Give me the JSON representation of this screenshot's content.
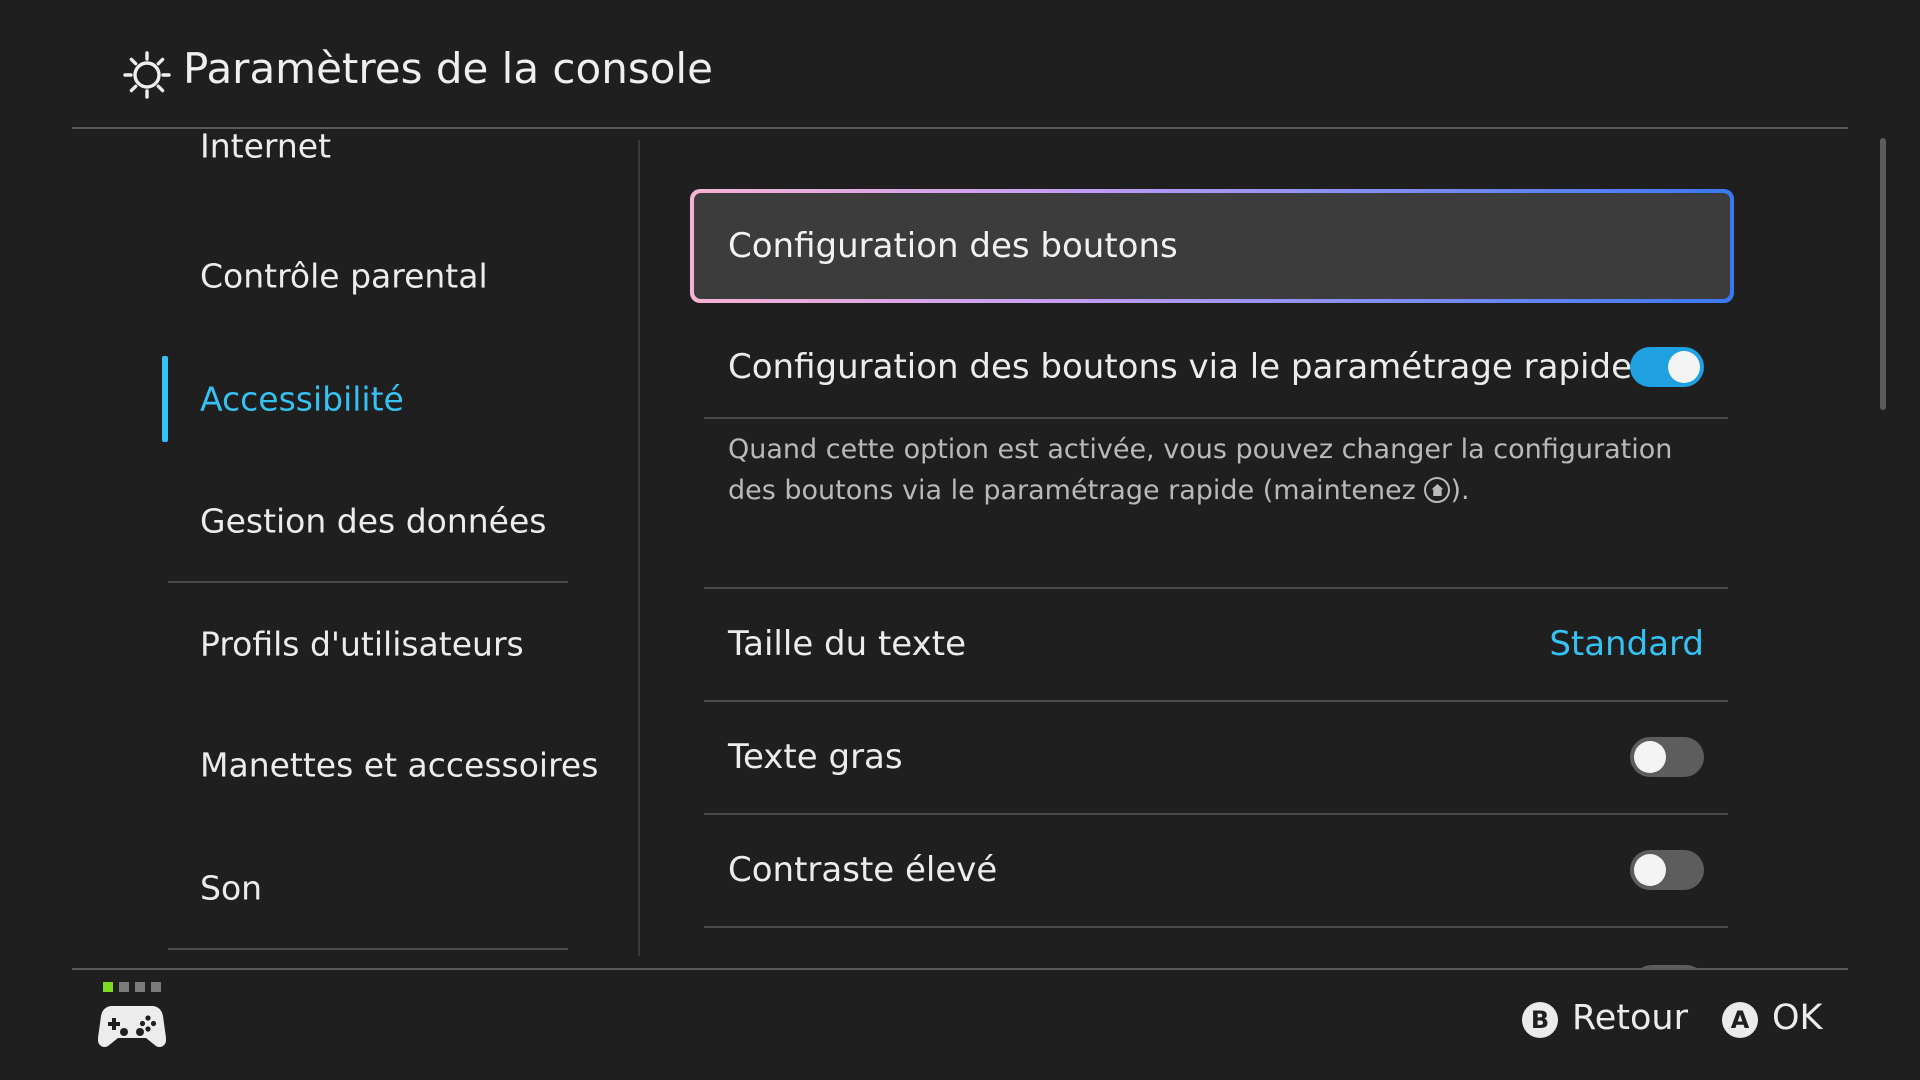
{
  "header": {
    "icon": "gear-icon",
    "title": "Paramètres de la console"
  },
  "sidebar": {
    "items": [
      {
        "label": "Internet"
      },
      {
        "label": "Contrôle parental"
      },
      {
        "label": "Accessibilité",
        "active": true
      },
      {
        "label": "Gestion des données"
      },
      {
        "label": "Profils d'utilisateurs"
      },
      {
        "label": "Manettes et accessoires"
      },
      {
        "label": "Son"
      }
    ]
  },
  "content": {
    "button_config": {
      "label": "Configuration des boutons"
    },
    "quick_config": {
      "label": "Configuration des boutons via le paramétrage rapide",
      "toggle_on": true
    },
    "description": {
      "part1": "Quand cette option est activée, vous pouvez changer la configuration des boutons via le paramétrage rapide (maintenez ",
      "icon": "home-button-icon",
      "part2": ")."
    },
    "text_size": {
      "label": "Taille du texte",
      "value": "Standard"
    },
    "bold_text": {
      "label": "Texte gras",
      "toggle_on": false
    },
    "high_contrast": {
      "label": "Contraste élevé",
      "toggle_on": false
    }
  },
  "footer": {
    "controller_icon": "controller-icon",
    "back": {
      "glyph": "B",
      "label": "Retour"
    },
    "ok": {
      "glyph": "A",
      "label": "OK"
    }
  },
  "colors": {
    "accent": "#35c2f2",
    "toggle_on": "#1fa0e0",
    "background": "#1f1f1f",
    "player_indicator_active": "#7ddc1f"
  }
}
